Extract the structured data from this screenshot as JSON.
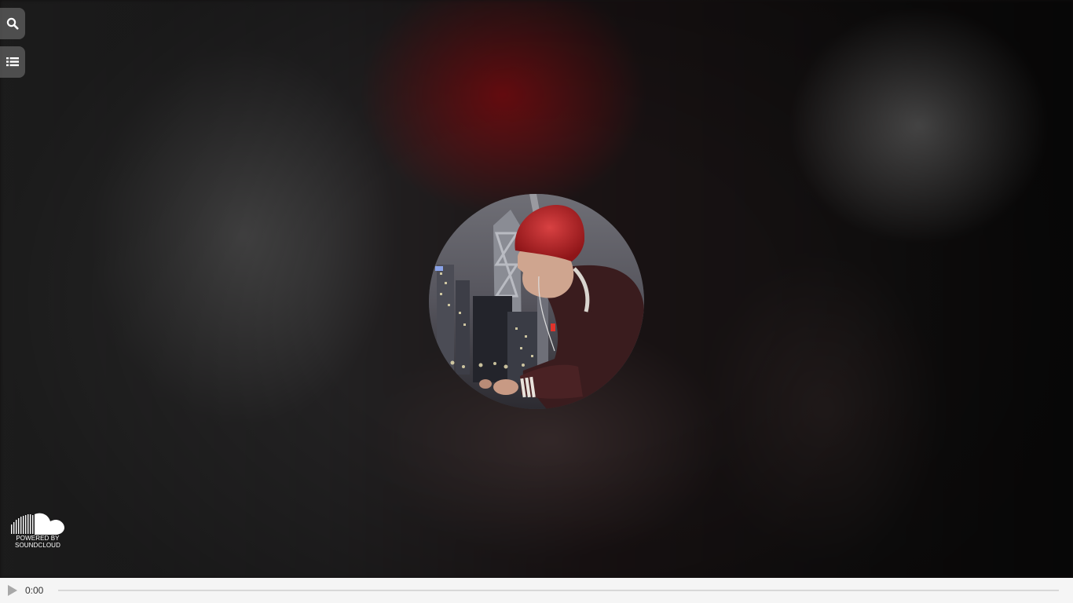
{
  "sidebar": {
    "buttons": [
      {
        "name": "search",
        "icon": "search-icon"
      },
      {
        "name": "playlist",
        "icon": "list-icon"
      }
    ]
  },
  "artwork": {
    "description_icon": "album-artwork"
  },
  "branding": {
    "icon": "soundcloud-cloud-icon",
    "line1": "POWERED BY",
    "line2": "SOUNDCLOUD"
  },
  "player": {
    "play_icon": "play-icon",
    "current_time": "0:00",
    "progress": 0,
    "accent_color": "#ff5500"
  }
}
